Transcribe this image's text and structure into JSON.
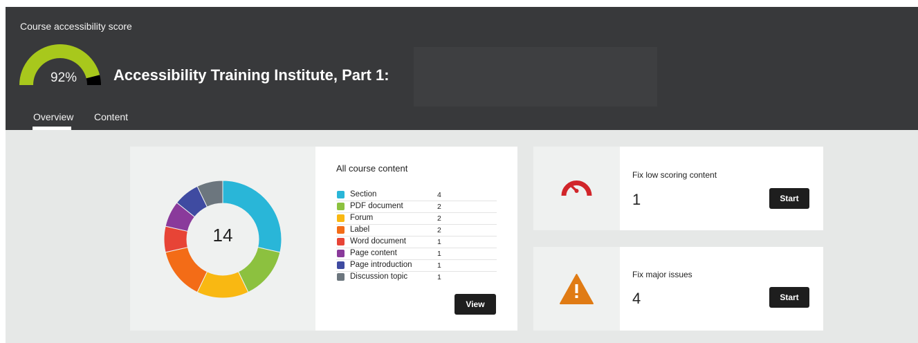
{
  "header": {
    "label": "Course accessibility score",
    "score": "92%",
    "score_fraction": 0.92,
    "course_title": "Accessibility Training Institute, Part 1:"
  },
  "tabs": [
    {
      "label": "Overview",
      "active": true
    },
    {
      "label": "Content",
      "active": false
    }
  ],
  "content_summary": {
    "title": "All course content",
    "total": "14",
    "items": [
      {
        "name": "Section",
        "count": "4",
        "color": "#29b6d8"
      },
      {
        "name": "PDF document",
        "count": "2",
        "color": "#8cc13f"
      },
      {
        "name": "Forum",
        "count": "2",
        "color": "#f9b812"
      },
      {
        "name": "Label",
        "count": "2",
        "color": "#f36c17"
      },
      {
        "name": "Word document",
        "count": "1",
        "color": "#e74436"
      },
      {
        "name": "Page content",
        "count": "1",
        "color": "#8a3a9b"
      },
      {
        "name": "Page introduction",
        "count": "1",
        "color": "#3f4ba1"
      },
      {
        "name": "Discussion topic",
        "count": "1",
        "color": "#6c767e"
      }
    ],
    "view_label": "View"
  },
  "actions": {
    "low_scoring": {
      "title": "Fix low scoring content",
      "count": "1",
      "button": "Start",
      "icon": "speedometer-icon",
      "icon_color": "#d1252a"
    },
    "major_issues": {
      "title": "Fix major issues",
      "count": "4",
      "button": "Start",
      "icon": "warning-icon",
      "icon_color": "#e07b14"
    }
  },
  "colors": {
    "header_bg": "#38393b",
    "gauge_fill": "#a8c81c",
    "page_bg": "#e6e8e7"
  }
}
